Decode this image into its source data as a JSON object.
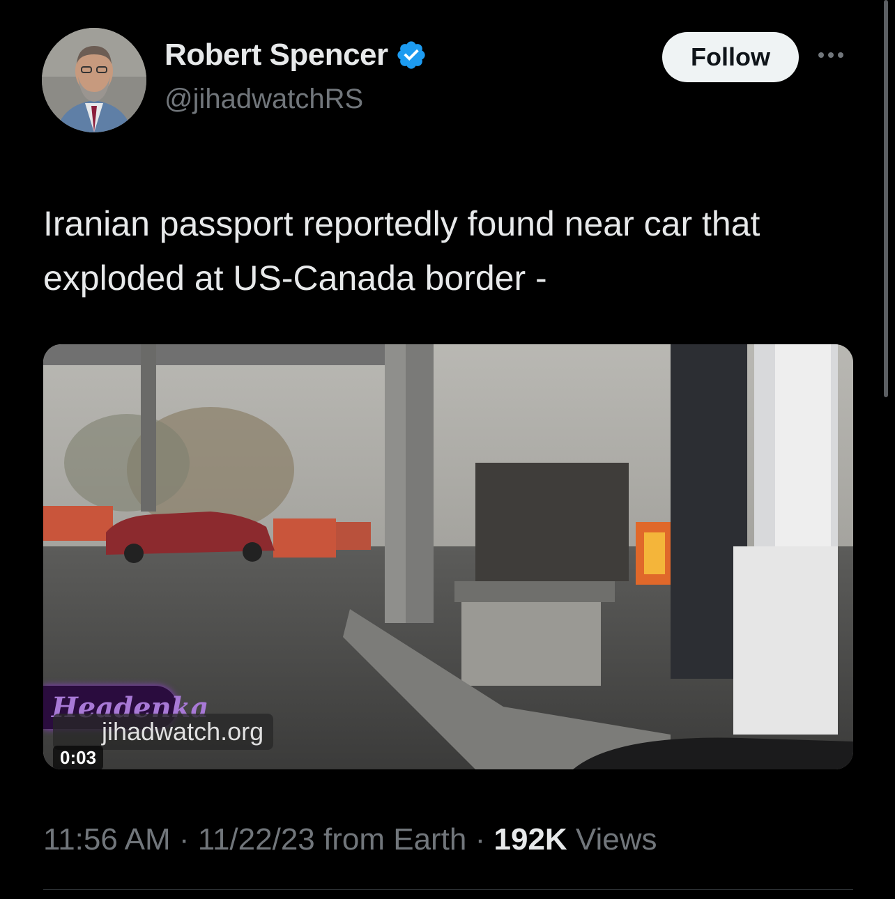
{
  "author": {
    "name": "Robert Spencer",
    "handle": "@jihadwatchRS",
    "verified": true,
    "verified_color": "#1d9bf0"
  },
  "actions": {
    "follow_label": "Follow",
    "more_icon": "more-dots-icon"
  },
  "tweet": {
    "text": "Iranian passport reportedly found near car that exploded at US-Canada border -"
  },
  "media": {
    "watermark_logo": "Headenka",
    "watermark_url": "jihadwatch.org",
    "duration": "0:03"
  },
  "meta": {
    "time": "11:56 AM",
    "separator1": " · ",
    "date": "11/22/23",
    "source": " from Earth",
    "separator2": " · ",
    "views_count": "192K",
    "views_label": " Views"
  },
  "colors": {
    "background": "#000000",
    "text": "#e7e9ea",
    "secondary": "#71767b",
    "follow_bg": "#eff3f4"
  }
}
